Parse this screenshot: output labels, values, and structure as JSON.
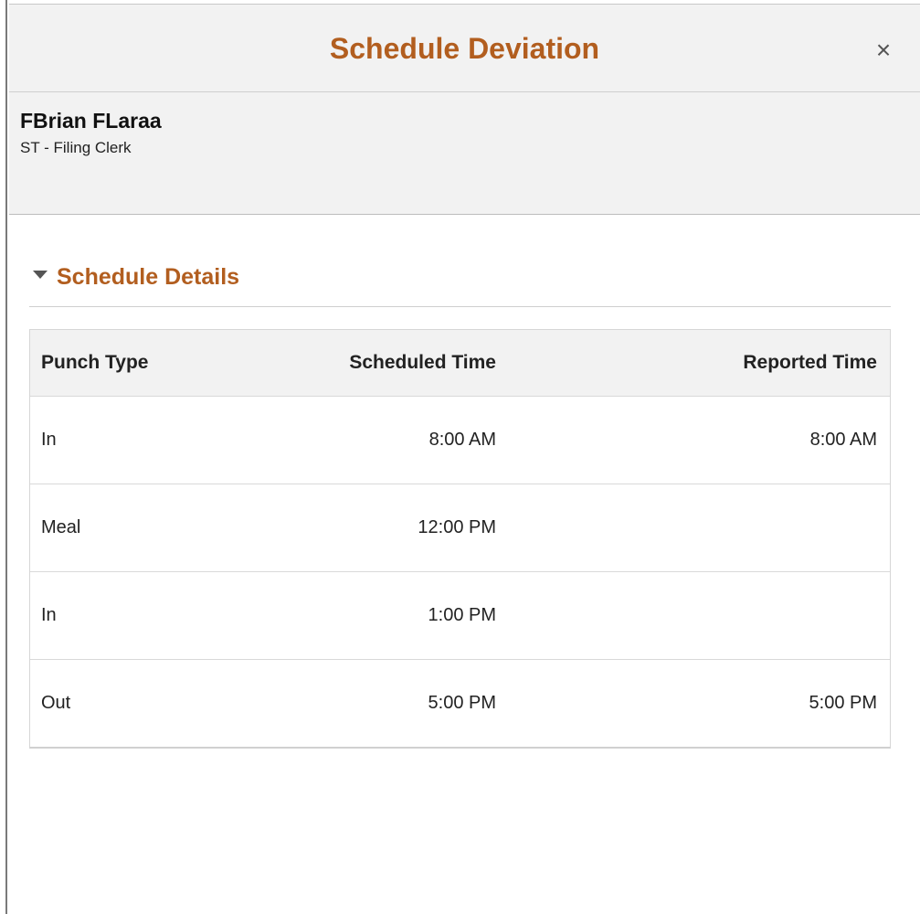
{
  "modal": {
    "title": "Schedule Deviation",
    "close_icon": "close-icon",
    "close_glyph": "×"
  },
  "employee": {
    "name": "FBrian FLaraa",
    "job": "ST - Filing Clerk"
  },
  "schedule_details": {
    "title": "Schedule Details",
    "expand_icon": "triangle-down-icon",
    "columns": [
      "Punch Type",
      "Scheduled Time",
      "Reported Time"
    ],
    "rows": [
      {
        "type": "In",
        "scheduled": "8:00 AM",
        "reported": "8:00 AM"
      },
      {
        "type": "Meal",
        "scheduled": "12:00 PM",
        "reported": ""
      },
      {
        "type": "In",
        "scheduled": "1:00 PM",
        "reported": ""
      },
      {
        "type": "Out",
        "scheduled": "5:00 PM",
        "reported": "5:00 PM"
      }
    ]
  },
  "colors": {
    "accent": "#b25e1f",
    "header_bg": "#f2f2f2",
    "border": "#d6d6d6"
  }
}
